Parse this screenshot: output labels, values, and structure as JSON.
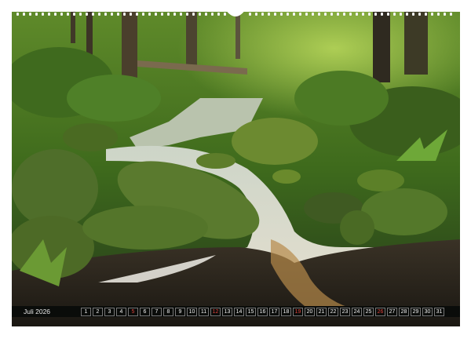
{
  "calendar": {
    "month_label": "Juli 2026",
    "days": [
      {
        "n": "1",
        "sunday": false
      },
      {
        "n": "2",
        "sunday": false
      },
      {
        "n": "3",
        "sunday": false
      },
      {
        "n": "4",
        "sunday": false
      },
      {
        "n": "5",
        "sunday": true
      },
      {
        "n": "6",
        "sunday": false
      },
      {
        "n": "7",
        "sunday": false
      },
      {
        "n": "8",
        "sunday": false
      },
      {
        "n": "9",
        "sunday": false
      },
      {
        "n": "10",
        "sunday": false
      },
      {
        "n": "11",
        "sunday": false
      },
      {
        "n": "12",
        "sunday": true
      },
      {
        "n": "13",
        "sunday": false
      },
      {
        "n": "14",
        "sunday": false
      },
      {
        "n": "15",
        "sunday": false
      },
      {
        "n": "16",
        "sunday": false
      },
      {
        "n": "17",
        "sunday": false
      },
      {
        "n": "18",
        "sunday": false
      },
      {
        "n": "19",
        "sunday": true
      },
      {
        "n": "20",
        "sunday": false
      },
      {
        "n": "21",
        "sunday": false
      },
      {
        "n": "22",
        "sunday": false
      },
      {
        "n": "23",
        "sunday": false
      },
      {
        "n": "24",
        "sunday": false
      },
      {
        "n": "25",
        "sunday": false
      },
      {
        "n": "26",
        "sunday": true
      },
      {
        "n": "27",
        "sunday": false
      },
      {
        "n": "28",
        "sunday": false
      },
      {
        "n": "29",
        "sunday": false
      },
      {
        "n": "30",
        "sunday": false
      },
      {
        "n": "31",
        "sunday": false
      }
    ]
  },
  "colors": {
    "sunday": "#e0413a",
    "weekday": "#f0f0f0",
    "bar": "#0a0c0a"
  }
}
